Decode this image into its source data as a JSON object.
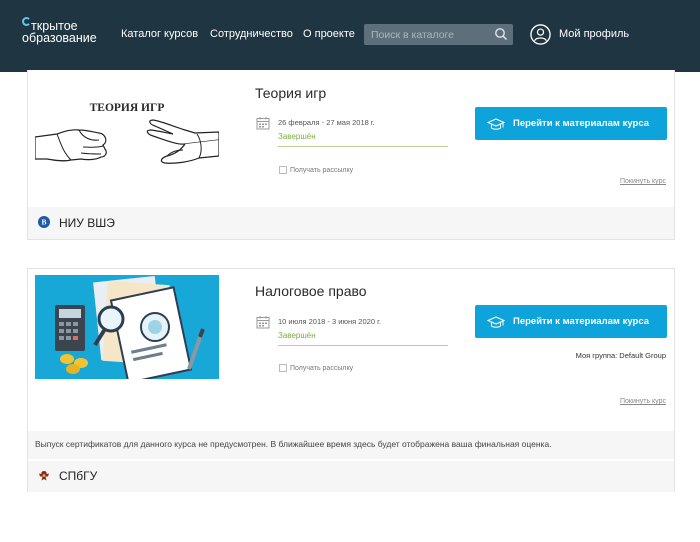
{
  "header": {
    "logo_line1": "ткрытое",
    "logo_line2": "образование",
    "nav": [
      "Каталог курсов",
      "Сотрудничество",
      "О проекте"
    ],
    "search_placeholder": "Поиск в каталоге",
    "profile_label": "Мой профиль"
  },
  "courses": [
    {
      "thumb_title": "ТЕОРИЯ ИГР",
      "title": "Теория игр",
      "dates": "26 февраля - 27 мая 2018 г.",
      "status": "Завершён",
      "newsletter_label": "Получать рассылку",
      "button_label": "Перейти к материалам курса",
      "hide_label": "Покинуть курс",
      "university": "НИУ ВШЭ"
    },
    {
      "title": "Налоговое право",
      "dates": "10 июля 2018 - 3 июня 2020 г.",
      "status": "Завершён",
      "newsletter_label": "Получать рассылку",
      "button_label": "Перейти к материалам курса",
      "group_label": "Моя группа: Default Group",
      "hide_label": "Покинуть курс",
      "cert_note": "Выпуск сертификатов для данного курса не предусмотрен. В ближайшее время здесь будет отображена ваша финальная оценка.",
      "university": "СПбГУ"
    }
  ],
  "colors": {
    "header_bg": "#1f3642",
    "accent_button": "#0ea3db",
    "status_green": "#7cae3d",
    "logo_ring": "#5ec8e8"
  },
  "icons": [
    "search-icon",
    "user-avatar-icon",
    "calendar-icon",
    "graduation-cap-icon",
    "hse-logo-icon",
    "spbu-crest-icon"
  ]
}
